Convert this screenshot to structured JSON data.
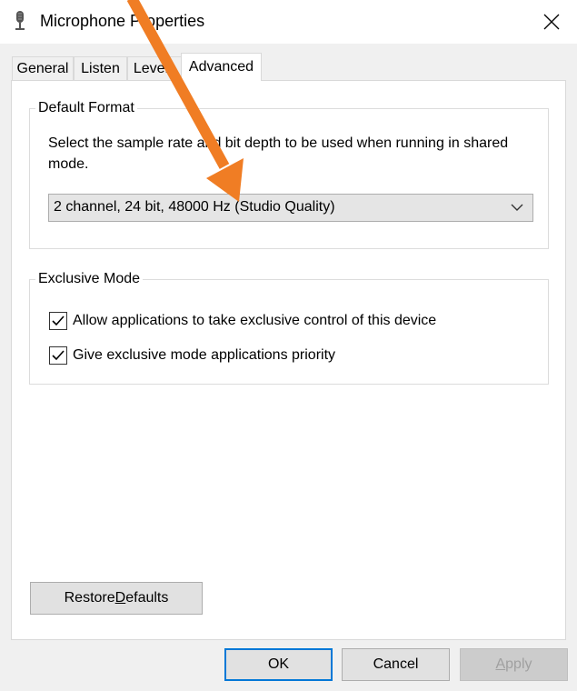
{
  "window": {
    "title": "Microphone Properties",
    "icon": "microphone-icon",
    "close_icon": "close-icon"
  },
  "tabs": [
    {
      "label": "General"
    },
    {
      "label": "Listen"
    },
    {
      "label": "Levels"
    },
    {
      "label": "Advanced"
    }
  ],
  "active_tab": "Advanced",
  "default_format": {
    "legend": "Default Format",
    "description": "Select the sample rate and bit depth to be used when running in shared mode.",
    "selected_format": "2 channel, 24 bit, 48000 Hz (Studio Quality)",
    "dropdown_icon": "chevron-down-icon"
  },
  "exclusive_mode": {
    "legend": "Exclusive Mode",
    "options": [
      {
        "label": "Allow applications to take exclusive control of this device",
        "checked": true
      },
      {
        "label": "Give exclusive mode applications priority",
        "checked": true
      }
    ]
  },
  "buttons": {
    "restore_defaults_pre": "Restore ",
    "restore_defaults_u": "D",
    "restore_defaults_post": "efaults",
    "ok": "OK",
    "cancel": "Cancel",
    "apply_u": "A",
    "apply_post": "pply"
  },
  "annotation": {
    "arrow_color": "#f07d24",
    "arrow_icon": "pointer-arrow-annotation"
  }
}
